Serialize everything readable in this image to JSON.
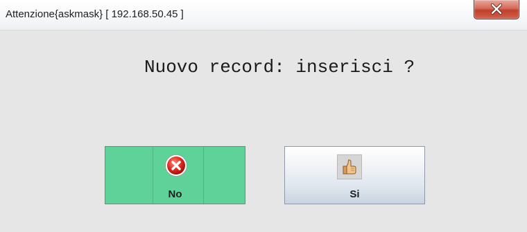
{
  "window": {
    "title": "Attenzione{askmask} [ 192.168.50.45 ]",
    "close_icon": "close-icon"
  },
  "dialog": {
    "message": "Nuovo record: inserisci ?"
  },
  "buttons": {
    "no": {
      "label": "No",
      "icon": "cancel-icon",
      "color": "#5fd29a"
    },
    "si": {
      "label": "Si",
      "icon": "thumbs-up-icon"
    }
  }
}
